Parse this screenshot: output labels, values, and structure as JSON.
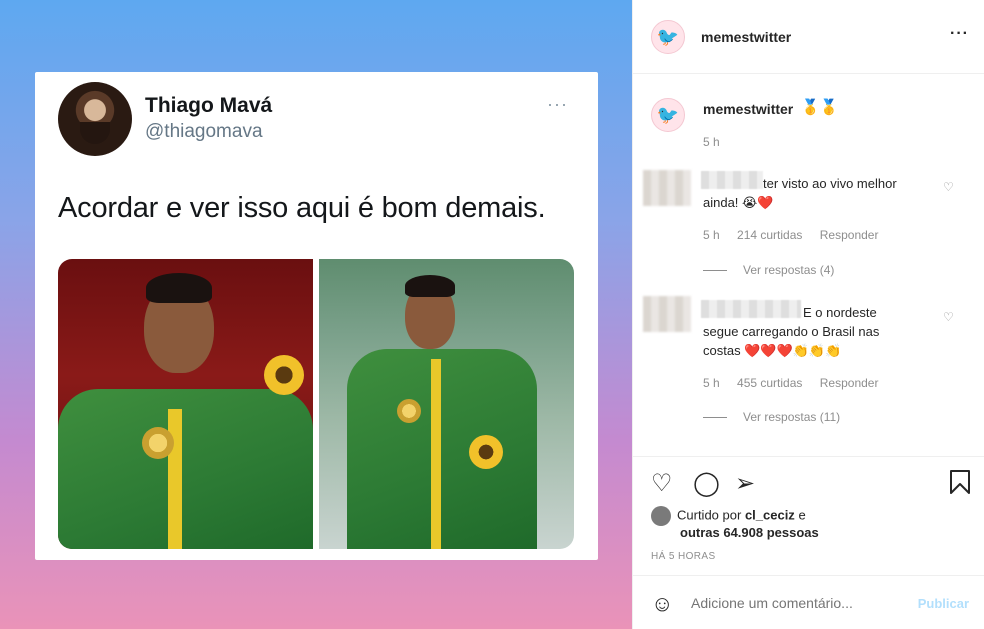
{
  "tweet": {
    "name": "Thiago Mavá",
    "handle": "@thiagomava",
    "more": "···",
    "text": "Acordar e ver isso aqui é bom demais."
  },
  "header": {
    "username": "memestwitter",
    "more": "···"
  },
  "caption": {
    "username": "memestwitter",
    "medals": "🥇🥇",
    "time": "5 h"
  },
  "comments": [
    {
      "text_line1": "ter visto ao vivo melhor",
      "text_line2": "ainda! 😭❤️",
      "time": "5 h",
      "likes": "214 curtidas",
      "reply": "Responder",
      "view_replies": "Ver respostas (4)"
    },
    {
      "text_line1": "E o nordeste",
      "text_line2": "segue carregando o Brasil nas",
      "text_line3": "costas ❤️❤️❤️👏👏👏",
      "time": "5 h",
      "likes": "455 curtidas",
      "reply": "Responder",
      "view_replies": "Ver respostas (11)"
    }
  ],
  "actions": {
    "like_icon": "heart-icon",
    "comment_icon": "comment-icon",
    "share_icon": "share-icon",
    "save_icon": "bookmark-icon"
  },
  "likes": {
    "prefix": "Curtido por",
    "user": "cl_ceciz",
    "conj": "e",
    "others": "outras 64.908 pessoas"
  },
  "date": "HÁ 5 HORAS",
  "comment_box": {
    "placeholder": "Adicione um comentário...",
    "publish": "Publicar"
  }
}
